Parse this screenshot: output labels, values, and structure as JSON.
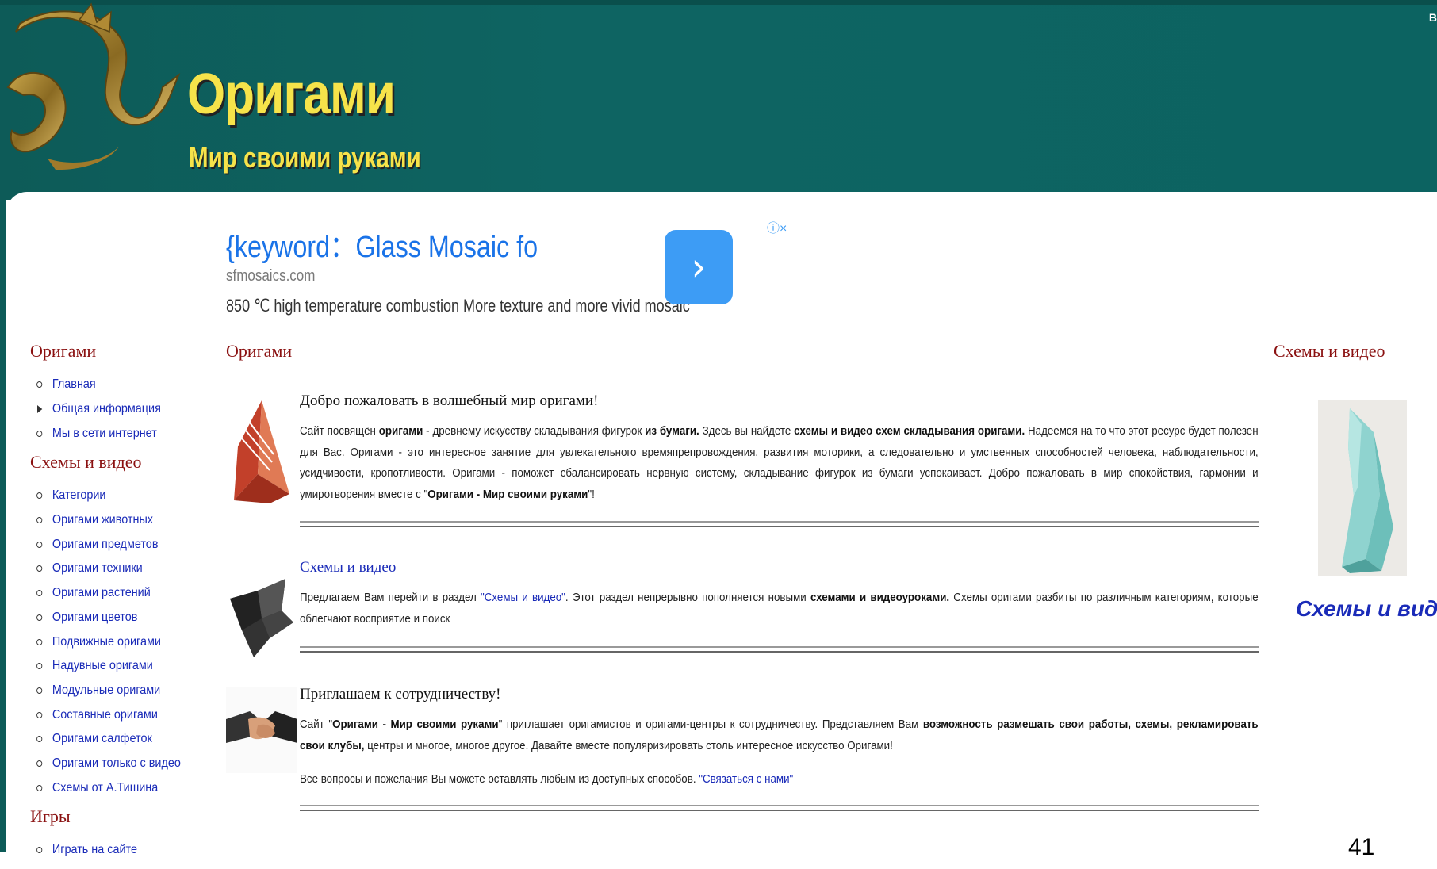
{
  "header": {
    "title": "Оригами",
    "subtitle": "Мир своими руками",
    "corner_char": "В"
  },
  "ad": {
    "title": "{keyword：Glass Mosaic fo",
    "domain": "sfmosaics.com",
    "description": "850 ℃ high temperature combustion More texture and more vivid mosaic",
    "arrow": "›",
    "info": "ⓘ×"
  },
  "sidebar": {
    "sections": [
      {
        "heading": "Оригами",
        "items": [
          "Главная",
          "Общая информация",
          "Мы в сети интернет"
        ]
      },
      {
        "heading": "Схемы и видео",
        "items": [
          "Категории",
          "Оригами животных",
          "Оригами предметов",
          "Оригами техники",
          "Оригами растений",
          "Оригами цветов",
          "Подвижные оригами",
          "Надувные оригами",
          "Модульные оригами",
          "Составные оригами",
          "Оригами салфеток",
          "Оригами только с видео",
          "Схемы от А.Тишина"
        ]
      },
      {
        "heading": "Игры",
        "items": [
          "Играть на сайте"
        ]
      }
    ]
  },
  "main": {
    "heading": "Оригами",
    "welcome": {
      "title": "Добро пожаловать в волшебный мир оригами!",
      "t1": "Сайт посвящён ",
      "b1": "оригами",
      "t2": " - древнему искусству складывания фигурок ",
      "b2": "из бумаги.",
      "t3": " Здесь вы найдете ",
      "b3": "схемы и видео схем складывания оригами.",
      "t4": " Надеемся на то что этот ресурс будет полезен для Вас. Оригами - это интересное занятие для увлекательного времяпрепровождения, развития моторики, а следовательно и умственных способностей человека, наблюдательности, усидчивости, кропотливости. Оригами - поможет сбалансировать нервную систему, складывание фигурок из бумаги успокаивает. Добро пожаловать в мир спокойствия, гармонии и умиротворения вместе с \"",
      "b4": "Оригами - Мир своими руками",
      "t5": "\"!"
    },
    "schemes": {
      "title": "Схемы и видео",
      "t1": "Предлагаем Вам перейти в раздел ",
      "link": "\"Схемы и видео\"",
      "t2": ". Этот раздел непрерывно пополняется новыми ",
      "b1": "схемами и видеоуроками.",
      "t3": " Схемы оригами разбиты по различным категориям, которые облегчают восприятие и поиск"
    },
    "cooperation": {
      "title": "Приглашаем к сотрудничеству!",
      "t1": "Сайт \"",
      "b1": "Оригами - Мир своими руками",
      "t2": "\" приглашает оригамистов и оригами-центры к сотрудничеству. Представляем Вам ",
      "b2": "возможность размешать свои работы, схемы, рекламировать свои клубы,",
      "t3": " центры и многое, многое другое. Давайте вместе популяризировать столь интересное искусство Оригами!",
      "contact_text": "Все вопросы и пожелания Вы можете оставлять любым из доступных способов. ",
      "contact_link": "\"Связаться с нами\""
    }
  },
  "right": {
    "heading": "Схемы и видео",
    "link": "Схемы и видео"
  },
  "page_number": "41"
}
